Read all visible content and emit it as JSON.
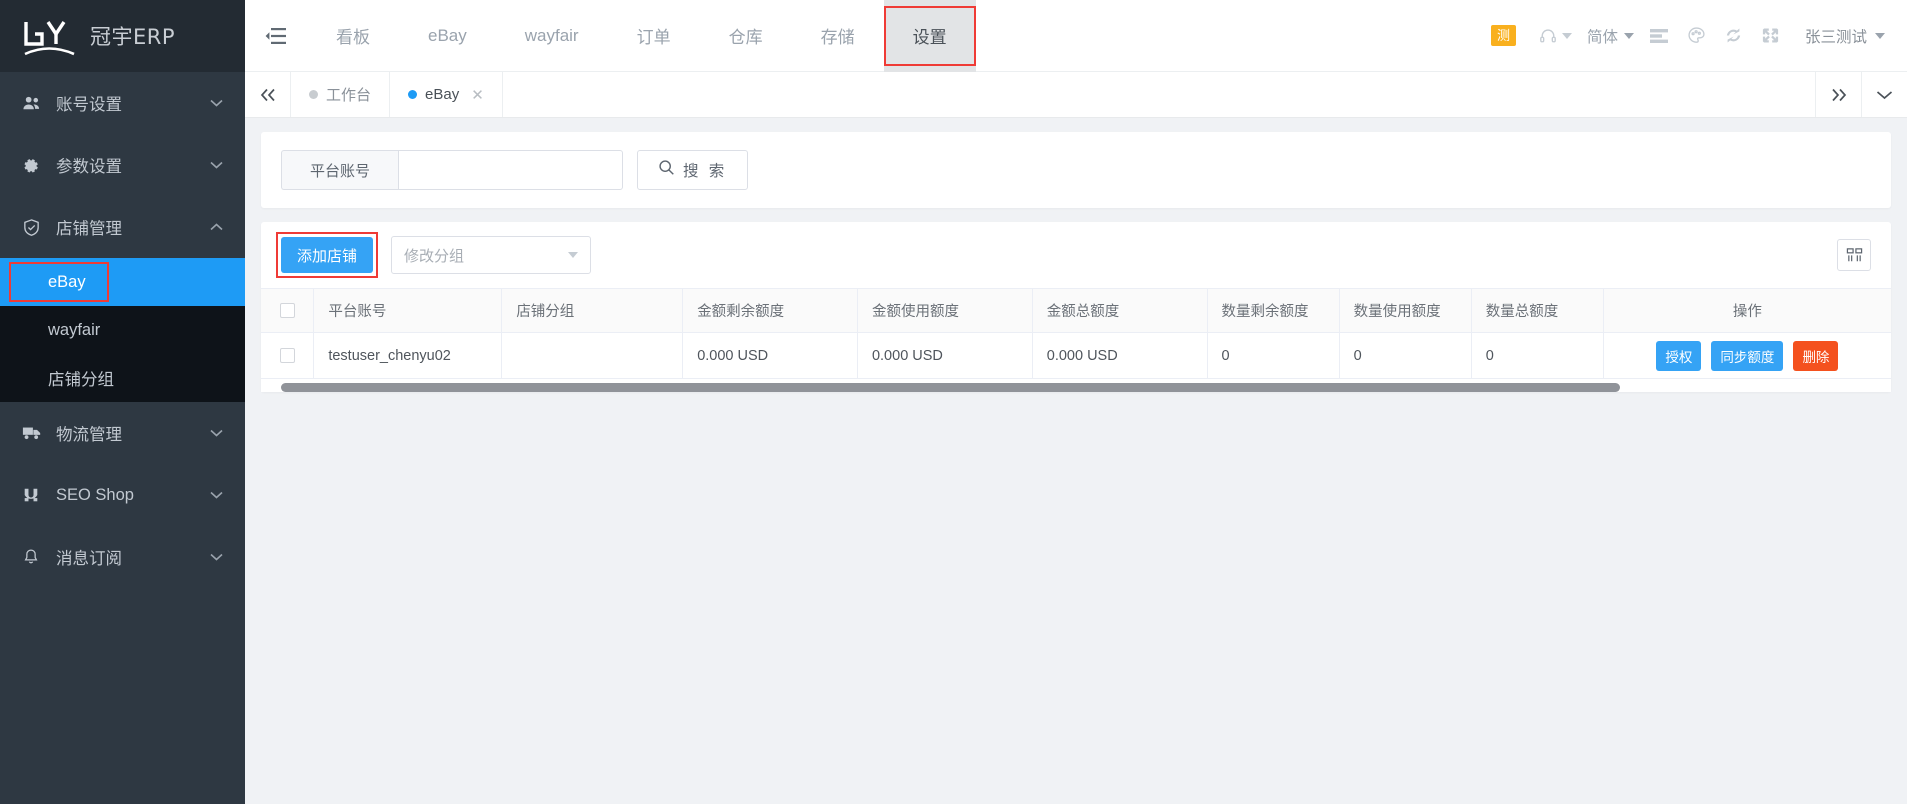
{
  "brand": {
    "logo_mark": "GY",
    "logo_text": "冠宇ERP"
  },
  "sidebar": {
    "items": [
      {
        "label": "账号设置",
        "icon": "users-icon",
        "arrow": "chevron-down-icon"
      },
      {
        "label": "参数设置",
        "icon": "gear-icon",
        "arrow": "chevron-down-icon"
      },
      {
        "label": "店铺管理",
        "icon": "shield-check-icon",
        "arrow": "chevron-up-icon"
      }
    ],
    "submenu": [
      {
        "label": "eBay",
        "active": true
      },
      {
        "label": "wayfair",
        "active": false
      },
      {
        "label": "店铺分组",
        "active": false
      }
    ],
    "items_after": [
      {
        "label": "物流管理",
        "icon": "truck-icon",
        "arrow": "chevron-down-icon"
      },
      {
        "label": "SEO Shop",
        "icon": "magnet-icon",
        "arrow": "chevron-down-icon"
      },
      {
        "label": "消息订阅",
        "icon": "bell-icon",
        "arrow": "chevron-down-icon"
      }
    ]
  },
  "topbar": {
    "collapse_icon": "menu-collapse-icon",
    "nav": [
      {
        "label": "看板",
        "active": false
      },
      {
        "label": "eBay",
        "active": false
      },
      {
        "label": "wayfair",
        "active": false
      },
      {
        "label": "订单",
        "active": false
      },
      {
        "label": "仓库",
        "active": false
      },
      {
        "label": "存储",
        "active": false
      },
      {
        "label": "设置",
        "active": true
      }
    ],
    "badge": "测",
    "headset_icon": "headset-icon",
    "language": "简体",
    "list_icon": "list-icon",
    "palette_icon": "palette-icon",
    "refresh_icon": "refresh-icon",
    "fullscreen_icon": "fullscreen-icon",
    "user": "张三测试"
  },
  "tabbar": {
    "prev_icon": "chevron-double-left-icon",
    "next_icon": "chevron-double-right-icon",
    "dropdown_icon": "chevron-down-icon",
    "tabs": [
      {
        "label": "工作台",
        "active": false,
        "closable": false
      },
      {
        "label": "eBay",
        "active": true,
        "closable": true,
        "close_icon": "close-icon"
      }
    ]
  },
  "search": {
    "field_label": "平台账号",
    "field_value": "",
    "field_placeholder": "",
    "search_button": "搜 索",
    "search_icon": "search-icon"
  },
  "toolbar": {
    "add_shop_button": "添加店铺",
    "group_select_value": "修改分组",
    "group_select_icon": "chevron-down-icon",
    "column_settings_icon": "column-settings-icon"
  },
  "table": {
    "columns": [
      "平台账号",
      "店铺分组",
      "金额剩余额度",
      "金额使用额度",
      "金额总额度",
      "数量剩余额度",
      "数量使用额度",
      "数量总额度",
      "操作"
    ],
    "rows": [
      {
        "checked": false,
        "platform_account": "testuser_chenyu02",
        "shop_group": "",
        "amount_remaining": "0.000 USD",
        "amount_used": "0.000 USD",
        "amount_total": "0.000 USD",
        "qty_remaining": "0",
        "qty_used": "0",
        "qty_total": "0",
        "actions": [
          {
            "label": "授权",
            "style": "blue"
          },
          {
            "label": "同步额度",
            "style": "blue"
          },
          {
            "label": "删除",
            "style": "red"
          }
        ]
      }
    ]
  },
  "colors": {
    "sidebar_bg": "#2e3842",
    "submenu_bg": "#0e1319",
    "accent_blue": "#1e9bf5",
    "primary_blue": "#35a3f5",
    "danger_red": "#f4511e",
    "highlight_red": "#ef3b36",
    "badge_orange": "#f9b01e"
  }
}
